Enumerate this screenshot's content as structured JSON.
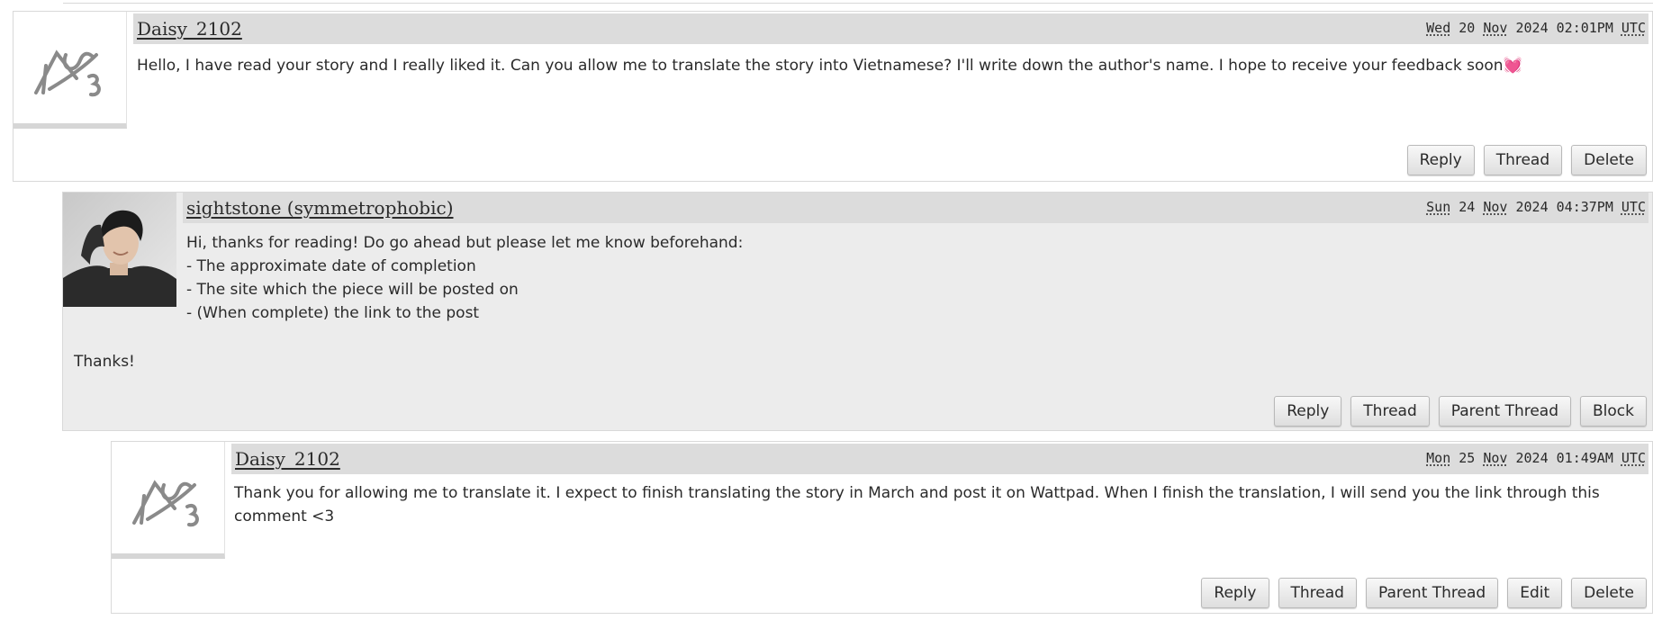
{
  "comments": [
    {
      "username": "Daisy_2102",
      "timestamp": {
        "day": "Wed",
        "date": "20",
        "month": "Nov",
        "year_time": "2024 02:01PM",
        "tz": "UTC"
      },
      "body": "Hello, I have read your story and I really liked it. Can you allow me to translate the story into Vietnamese? I'll write down the author's name. I hope to receive your feedback soon",
      "emoji": "💓",
      "actions": [
        "Reply",
        "Thread",
        "Delete"
      ]
    },
    {
      "username": "sightstone (symmetrophobic)",
      "timestamp": {
        "day": "Sun",
        "date": "24",
        "month": "Nov",
        "year_time": "2024 04:37PM",
        "tz": "UTC"
      },
      "body_lines": [
        "Hi, thanks for reading! Do go ahead but please let me know beforehand:",
        "- The approximate date of completion",
        "- The site which the piece will be posted on",
        "- (When complete) the link to the post"
      ],
      "closing": "Thanks!",
      "actions": [
        "Reply",
        "Thread",
        "Parent Thread",
        "Block"
      ]
    },
    {
      "username": "Daisy_2102",
      "timestamp": {
        "day": "Mon",
        "date": "25",
        "month": "Nov",
        "year_time": "2024 01:49AM",
        "tz": "UTC"
      },
      "body_lines": [
        "Thank you for allowing me to translate it. I expect to finish translating the story in March and post it on Wattpad. When I finish the translation, I will send you the link through this",
        "comment <3"
      ],
      "actions": [
        "Reply",
        "Thread",
        "Parent Thread",
        "Edit",
        "Delete"
      ]
    }
  ],
  "icons": {
    "default_userpic": "default-userpic-icon",
    "user_photo": "user-photo"
  },
  "colors": {
    "header_bg": "#dcdcdc",
    "alt_comment_bg": "#ececec",
    "button_border": "#b9b9b9",
    "heart": "#e84a7f"
  }
}
